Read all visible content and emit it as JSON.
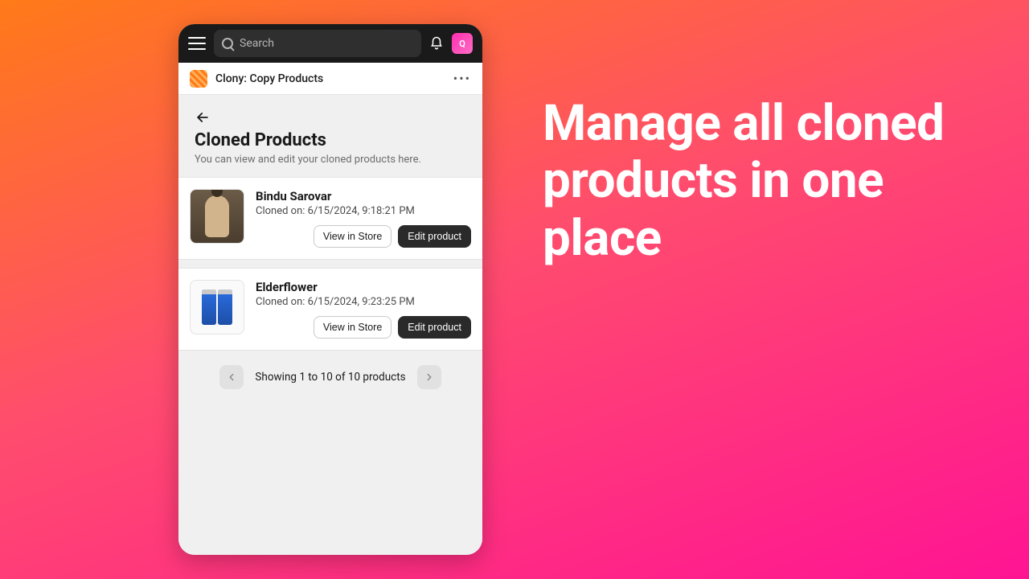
{
  "marketing": {
    "headline": "Manage all cloned products in one place"
  },
  "topbar": {
    "search_placeholder": "Search",
    "avatar_initials": "Q"
  },
  "appbar": {
    "app_name": "Clony: Copy Products"
  },
  "page": {
    "title": "Cloned Products",
    "subtitle": "You can view and edit your cloned products here."
  },
  "products": [
    {
      "title": "Bindu Sarovar",
      "cloned_on_label": "Cloned on: 6/15/2024, 9:18:21 PM",
      "thumb_kind": "person"
    },
    {
      "title": "Elderflower",
      "cloned_on_label": "Cloned on: 6/15/2024, 9:23:25 PM",
      "thumb_kind": "cans"
    }
  ],
  "buttons": {
    "view_in_store": "View in Store",
    "edit_product": "Edit product"
  },
  "pagination": {
    "text": "Showing 1 to 10 of 10 products"
  }
}
